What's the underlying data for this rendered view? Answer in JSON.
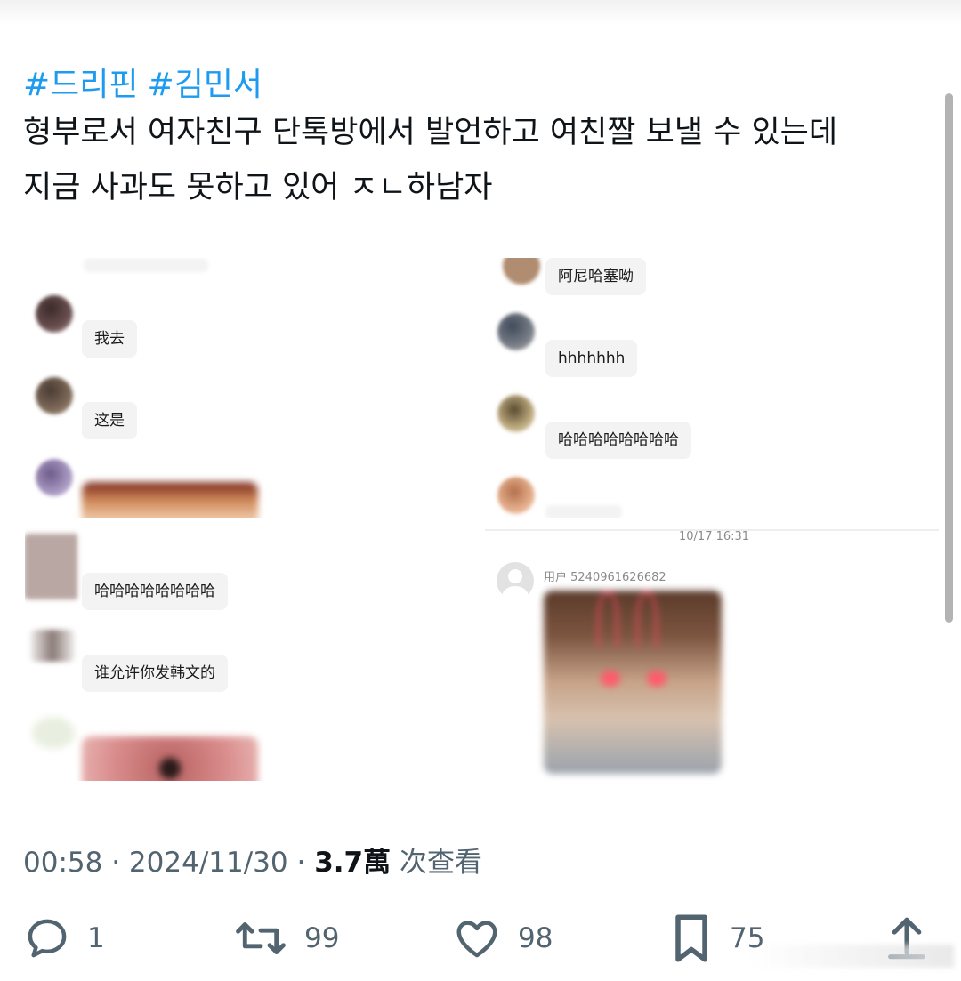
{
  "post": {
    "hashtags": [
      "#드리핀",
      "#김민서"
    ],
    "lines": [
      "형부로서 여자친구 단톡방에서 발언하고 여친짤 보낼 수 있는데",
      "지금 사과도 못하고 있어 ㅈㄴ하남자"
    ]
  },
  "chat_left_top": {
    "messages": [
      "我去",
      "这是"
    ]
  },
  "chat_right_top": {
    "messages": [
      "阿尼哈塞呦",
      "hhhhhhh",
      "哈哈哈哈哈哈哈哈"
    ]
  },
  "chat_left_bottom": {
    "messages": [
      "哈哈哈哈哈哈哈哈",
      "谁允许你发韩文的"
    ]
  },
  "chat_right_bottom": {
    "timestamp": "10/17 16:31",
    "username": "用户 5240961626682"
  },
  "meta": {
    "time": "00:58",
    "date": "2024/11/30",
    "views_count": "3.7萬",
    "views_label": " 次查看"
  },
  "actions": {
    "replies": "1",
    "reposts": "99",
    "likes": "98",
    "bookmarks": "75"
  },
  "colors": {
    "hashtag": "#1d9bf0",
    "text": "#0f1419",
    "secondary": "#536471"
  }
}
